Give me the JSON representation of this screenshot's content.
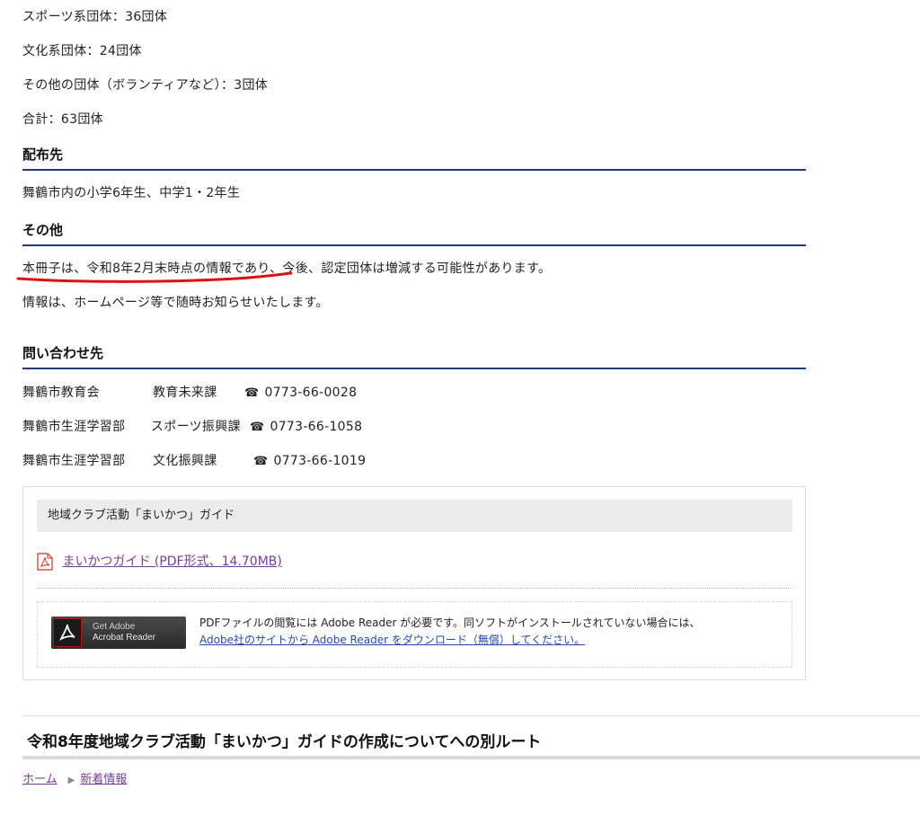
{
  "counts": {
    "sports": "スポーツ系団体：36団体",
    "culture": "文化系団体：24団体",
    "other": "その他の団体（ボランティアなど）：3団体",
    "total": "合計：63団体"
  },
  "distribution": {
    "heading": "配布先",
    "text": "舞鶴市内の小学6年生、中学1・2年生"
  },
  "misc": {
    "heading": "その他",
    "line1": "本冊子は、令和8年2月末時点の情報であり、今後、認定団体は増減する可能性があります。",
    "line2": "情報は、ホームページ等で随時お知らせいたします。"
  },
  "contact": {
    "heading": "問い合わせ先",
    "rows": [
      {
        "org": "舞鶴市教育会",
        "dept": "教育未来課",
        "phone": "0773-66-0028"
      },
      {
        "org": "舞鶴市生涯学習部",
        "dept": "スポーツ振興課",
        "phone": "0773-66-1058"
      },
      {
        "org": "舞鶴市生涯学習部",
        "dept": "文化振興課",
        "phone": "0773-66-1019"
      }
    ],
    "phone_glyph": "☎"
  },
  "attachment": {
    "title": "地域クラブ活動「まいかつ」ガイド",
    "file_link": "まいかつガイド (PDF形式、14.70MB)",
    "reader_badge_get": "Get Adobe",
    "reader_badge_product": "Acrobat Reader",
    "reader_text1": "PDFファイルの閲覧には Adobe Reader が必要です。同ソフトがインストールされていない場合には、",
    "reader_link": "Adobe社のサイトから Adobe Reader をダウンロード（無償）してください。"
  },
  "alt_route": {
    "title": "令和8年度地域クラブ活動「まいかつ」ガイドの作成についてへの別ルート"
  },
  "breadcrumb": {
    "home": "ホーム",
    "separator": "▶",
    "current": "新着情報"
  },
  "colors": {
    "heading_rule": "#1f3c7a",
    "link_visited": "#7a3d9a",
    "link": "#2a4ab0",
    "annotation_red": "#e01010"
  }
}
